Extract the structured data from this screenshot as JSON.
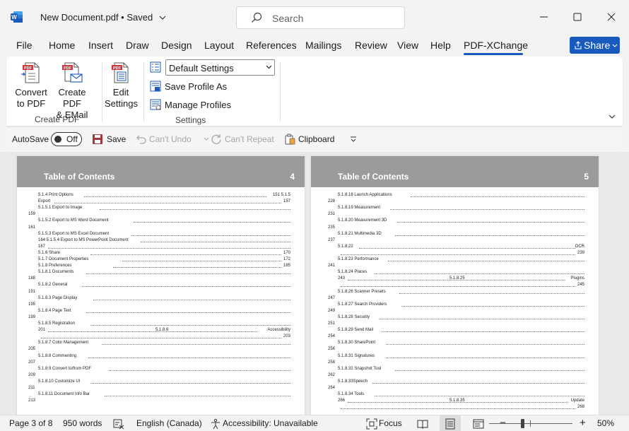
{
  "titlebar": {
    "doc_title": "New Document.pdf • Saved",
    "search_placeholder": "Search"
  },
  "menu": {
    "tabs": [
      "File",
      "Home",
      "Insert",
      "Draw",
      "Design",
      "Layout",
      "References",
      "Mailings",
      "Review",
      "View",
      "Help",
      "PDF-XChange"
    ],
    "active_tab": "PDF-XChange",
    "share_label": "Share"
  },
  "ribbon": {
    "create_pdf": {
      "convert_label_1": "Convert",
      "convert_label_2": "to PDF",
      "email_label_1": "Create PDF",
      "email_label_2": "& EMail",
      "group_label": "Create PDF"
    },
    "settings": {
      "edit_label_1": "Edit",
      "edit_label_2": "Settings",
      "profile_select": "Default Settings",
      "save_profile": "Save Profile As",
      "manage_profiles": "Manage Profiles",
      "group_label": "Settings"
    }
  },
  "qat": {
    "autosave_label": "AutoSave",
    "autosave_state": "Off",
    "save_label": "Save",
    "undo_label": "Can't Undo",
    "repeat_label": "Can't Repeat",
    "clipboard_label": "Clipboard"
  },
  "pages": [
    {
      "title": "Table of Contents",
      "number": "4",
      "lines": [
        {
          "t": "5.1.4 Print Options",
          "p": "151 5.1.5"
        },
        {
          "t": "Export",
          "p": "157"
        },
        {
          "t": "5.1.5.1    Export to Image",
          "p": ""
        },
        {
          "l": "159"
        },
        {
          "t": "5.1.5.2        Export to MS Word Document",
          "p": ""
        },
        {
          "l": "161"
        },
        {
          "t": "5.1.5.3  Export  to  MS  Excel  Document",
          "p": ""
        },
        {
          "t": "164 5.1.5.4 Export to MS PowerPoint Document",
          "p": ""
        },
        {
          "t": "167",
          "p": ""
        },
        {
          "t": "5.1.6            Share",
          "p": "170"
        },
        {
          "t": "5.1.7            Document Properties",
          "p": "172"
        },
        {
          "t": "5.1.8                Preferences",
          "p": "185"
        },
        {
          "t": "5.1.8.1    Documents",
          "p": ""
        },
        {
          "l": "188"
        },
        {
          "t": "5.1.8.2    General",
          "p": ""
        },
        {
          "l": "191"
        },
        {
          "t": "5.1.8.3    Page Display",
          "p": ""
        },
        {
          "l": "195"
        },
        {
          "t": "5.1.8.4    Page Text",
          "p": ""
        },
        {
          "l": "199"
        },
        {
          "t": "5.1.8.5   Registration",
          "p": ""
        },
        {
          "t": "201",
          "m": "5.1.8.6",
          "p": "Accessibility"
        },
        {
          "t": "",
          "p": "203"
        },
        {
          "t": "5.1.8.7    Color Management",
          "p": ""
        },
        {
          "l": "205"
        },
        {
          "t": "5.1.8.8    Commenting",
          "p": ""
        },
        {
          "l": "207"
        },
        {
          "t": "5.1.8.9    Convert to/from PDF",
          "p": ""
        },
        {
          "l": "209"
        },
        {
          "t": "5.1.8.10  Customize UI",
          "p": ""
        },
        {
          "l": "211"
        },
        {
          "t": "5.1.8.11   Document Info Bar",
          "p": ""
        },
        {
          "l": "213"
        }
      ]
    },
    {
      "title": "Table of Contents",
      "number": "5",
      "lines": [
        {
          "t": "5.1.8.18    Launch Applications",
          "p": ""
        },
        {
          "l": "228"
        },
        {
          "t": "5.1.8.19   Measurement",
          "p": ""
        },
        {
          "l": "231"
        },
        {
          "t": "5.1.8.20   Measurement 3D",
          "p": ""
        },
        {
          "l": "235"
        },
        {
          "t": "5.1.8.21   Multimedia 3D",
          "p": ""
        },
        {
          "l": "237"
        },
        {
          "t": "5.1.8.22",
          "p": "OCR"
        },
        {
          "t": "",
          "p": "239"
        },
        {
          "t": "5.1.8.23  Performance",
          "p": ""
        },
        {
          "l": "241"
        },
        {
          "t": "5.1.8.24 Places",
          "p": ""
        },
        {
          "t": "243",
          "m": "5.1.8.25",
          "p": "Plugins"
        },
        {
          "t": "",
          "p": "245"
        },
        {
          "t": "5.1.8.26   Scanner Presets",
          "p": ""
        },
        {
          "l": "247"
        },
        {
          "t": "5.1.8.27   Search Providers",
          "p": ""
        },
        {
          "l": "249"
        },
        {
          "t": "5.1.8.28 Security",
          "p": ""
        },
        {
          "l": "251"
        },
        {
          "t": "5.1.8.29 Send Mail",
          "p": ""
        },
        {
          "l": "254"
        },
        {
          "t": "5.1.8.30  SharePoint",
          "p": ""
        },
        {
          "l": "256"
        },
        {
          "t": "5.1.8.31  Signatures",
          "p": ""
        },
        {
          "l": "258"
        },
        {
          "t": "5.1.8.32   Snapshot Tool",
          "p": ""
        },
        {
          "l": "262"
        },
        {
          "t": "5.1.8.33Speech",
          "p": ""
        },
        {
          "l": "264"
        },
        {
          "t": "5.1.8.34  Tools",
          "p": ""
        },
        {
          "t": "266",
          "m": "5.1.8.35",
          "p": "Update"
        },
        {
          "t": "",
          "p": "268"
        }
      ]
    }
  ],
  "statusbar": {
    "page": "Page 3 of 8",
    "words": "950 words",
    "language": "English (Canada)",
    "accessibility": "Accessibility: Unavailable",
    "focus": "Focus",
    "zoom": "50%"
  },
  "colors": {
    "accent": "#185abd",
    "page_header": "#9b9b9b",
    "word_blue": "#2b579a"
  },
  "icons": [
    "word-app-icon",
    "search-icon",
    "minimize-icon",
    "maximize-icon",
    "close-icon",
    "share-icon",
    "convert-pdf-icon",
    "email-pdf-icon",
    "edit-settings-icon",
    "profile-list-icon",
    "save-profile-icon",
    "manage-profiles-icon",
    "save-icon",
    "undo-icon",
    "repeat-icon",
    "clipboard-icon",
    "customize-icon",
    "ribbon-collapse-icon",
    "proofing-icon",
    "accessibility-icon",
    "focus-icon",
    "read-mode-icon",
    "print-layout-icon",
    "web-layout-icon"
  ]
}
